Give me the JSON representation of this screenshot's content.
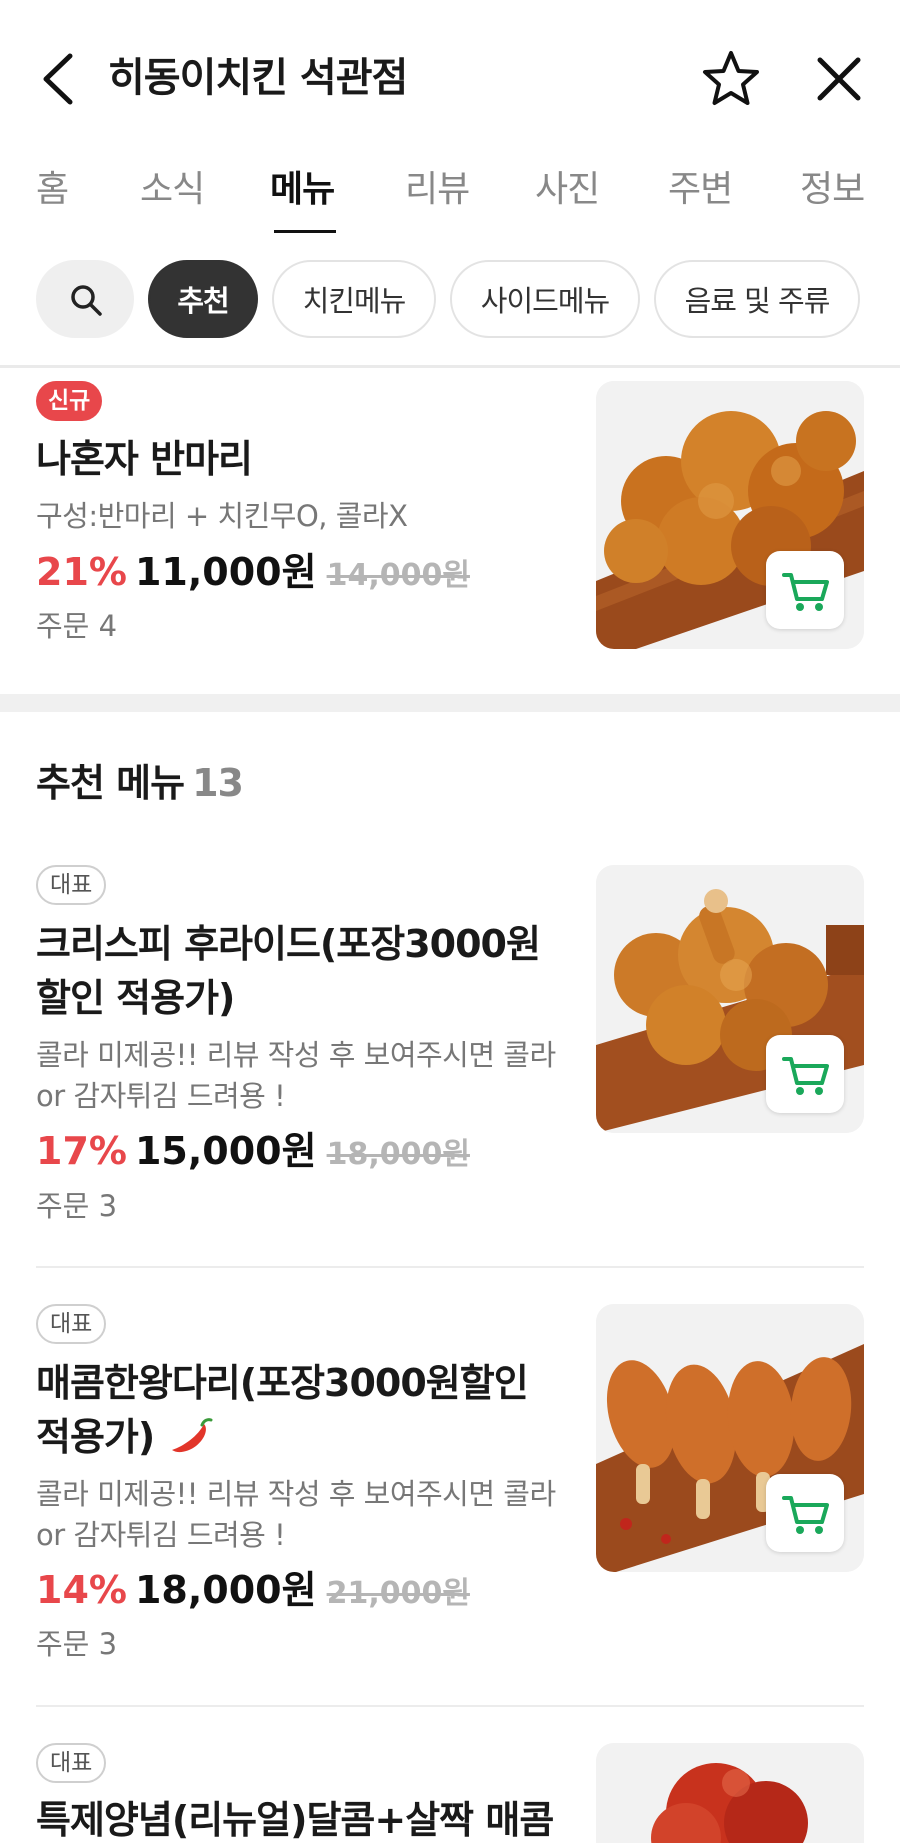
{
  "header": {
    "title": "히동이치킨 석관점",
    "back_icon": "chevron-left-icon",
    "favorite_icon": "star-outline-icon",
    "close_icon": "close-icon"
  },
  "tabs": [
    {
      "label": "홈"
    },
    {
      "label": "소식"
    },
    {
      "label": "메뉴",
      "active": true
    },
    {
      "label": "리뷰"
    },
    {
      "label": "사진"
    },
    {
      "label": "주변"
    },
    {
      "label": "정보"
    }
  ],
  "chips": {
    "search_icon": "search-icon",
    "items": [
      {
        "label": "추천",
        "active": true
      },
      {
        "label": "치킨메뉴"
      },
      {
        "label": "사이드메뉴"
      },
      {
        "label": "음료 및 주류"
      }
    ]
  },
  "items": [
    {
      "badge": "신규",
      "name": "나혼자 반마리",
      "desc": "구성:반마리 + 치킨무O, 콜라X",
      "discount": "21%",
      "price": "11,000원",
      "original_price": "14,000원",
      "orders": "주문 4"
    },
    {
      "badge": "대표",
      "name": "크리스피 후라이드(포장3000원할인 적용가)",
      "desc": "콜라 미제공!! 리뷰 작성 후 보여주시면 콜라or 감자튀김 드려용 !",
      "discount": "17%",
      "price": "15,000원",
      "original_price": "18,000원",
      "orders": "주문 3"
    },
    {
      "badge": "대표",
      "name": "매콤한왕다리(포장3000원할인 적용가)",
      "desc": "콜라 미제공!! 리뷰 작성 후 보여주시면 콜라or 감자튀김 드려용 !",
      "discount": "14%",
      "price": "18,000원",
      "original_price": "21,000원",
      "orders": "주문 3"
    },
    {
      "badge": "대표",
      "name": "특제양념(리뉴얼)달콤+살짝 매콤"
    }
  ],
  "section": {
    "title": "추천 메뉴",
    "count": "13"
  },
  "colors": {
    "accent_red": "#e8474b",
    "cart_green": "#1aa85a",
    "active_chip": "#333333"
  }
}
